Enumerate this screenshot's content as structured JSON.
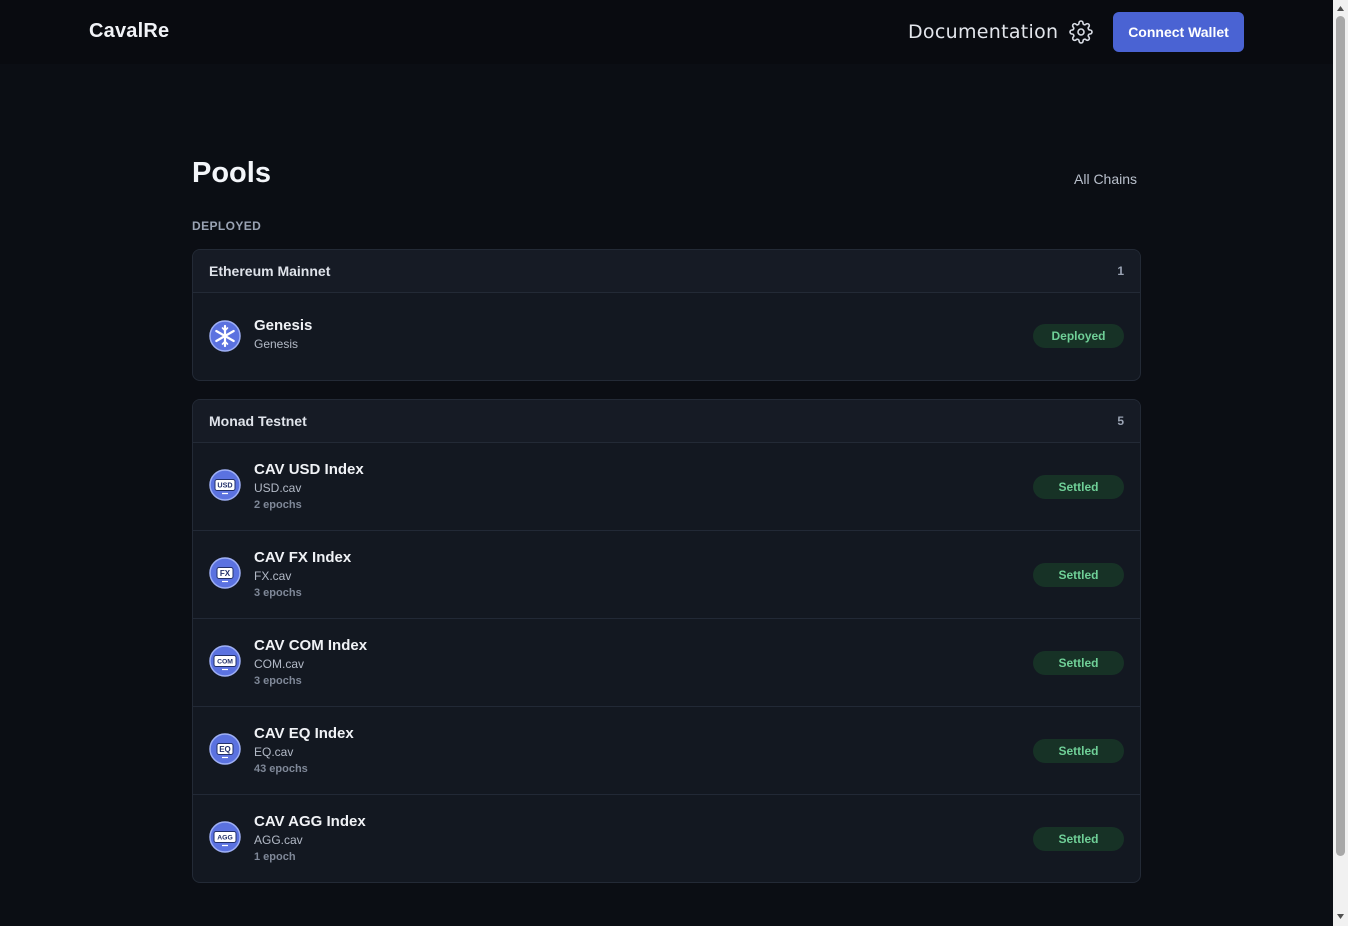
{
  "header": {
    "brand": "CavalRe",
    "documentation": "Documentation",
    "settings_icon": "gear-icon",
    "connect_wallet": "Connect Wallet"
  },
  "page": {
    "title": "Pools",
    "chain_filter": "All Chains",
    "section_label": "DEPLOYED"
  },
  "groups": [
    {
      "name": "Ethereum Mainnet",
      "count": "1",
      "pools": [
        {
          "name": "Genesis",
          "symbol": "Genesis",
          "epochs": "",
          "status": "Deployed",
          "icon": "snowflake-icon"
        }
      ]
    },
    {
      "name": "Monad Testnet",
      "count": "5",
      "pools": [
        {
          "name": "CAV USD Index",
          "symbol": "USD.cav",
          "epochs": "2 epochs",
          "status": "Settled",
          "icon": "usd-coin-icon",
          "icon_text": "USD"
        },
        {
          "name": "CAV FX Index",
          "symbol": "FX.cav",
          "epochs": "3 epochs",
          "status": "Settled",
          "icon": "fx-coin-icon",
          "icon_text": "FX"
        },
        {
          "name": "CAV COM Index",
          "symbol": "COM.cav",
          "epochs": "3 epochs",
          "status": "Settled",
          "icon": "com-coin-icon",
          "icon_text": "COM"
        },
        {
          "name": "CAV EQ Index",
          "symbol": "EQ.cav",
          "epochs": "43 epochs",
          "status": "Settled",
          "icon": "eq-coin-icon",
          "icon_text": "EQ"
        },
        {
          "name": "CAV AGG Index",
          "symbol": "AGG.cav",
          "epochs": "1 epoch",
          "status": "Settled",
          "icon": "agg-coin-icon",
          "icon_text": "AGG"
        }
      ]
    }
  ],
  "colors": {
    "background": "#0b0e14",
    "accent": "#4a63d3",
    "status_bg": "#173226",
    "status_text": "#6fcf97"
  }
}
